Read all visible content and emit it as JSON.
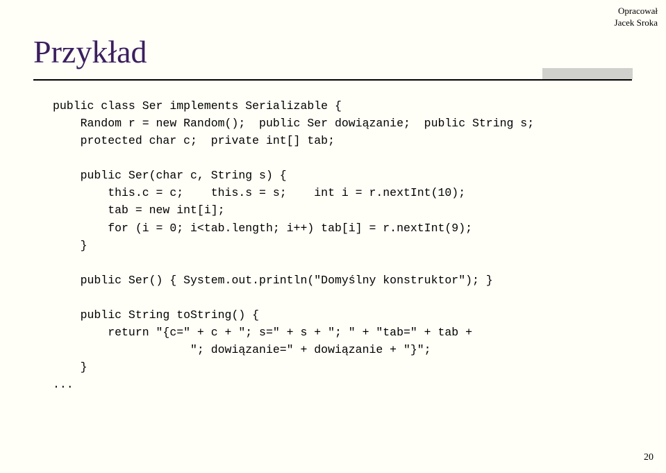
{
  "attribution": {
    "line1": "Opracował",
    "line2": "Jacek Sroka"
  },
  "title": "Przykład",
  "code": "public class Ser implements Serializable {\n    Random r = new Random();  public Ser dowiązanie;  public String s;\n    protected char c;  private int[] tab;\n\n    public Ser(char c, String s) {\n        this.c = c;    this.s = s;    int i = r.nextInt(10);\n        tab = new int[i];\n        for (i = 0; i<tab.length; i++) tab[i] = r.nextInt(9);\n    }\n\n    public Ser() { System.out.println(\"Domyślny konstruktor\"); }\n\n    public String toString() {\n        return \"{c=\" + c + \"; s=\" + s + \"; \" + \"tab=\" + tab +\n                    \"; dowiązanie=\" + dowiązanie + \"}\";\n    }\n...",
  "page_number": "20"
}
